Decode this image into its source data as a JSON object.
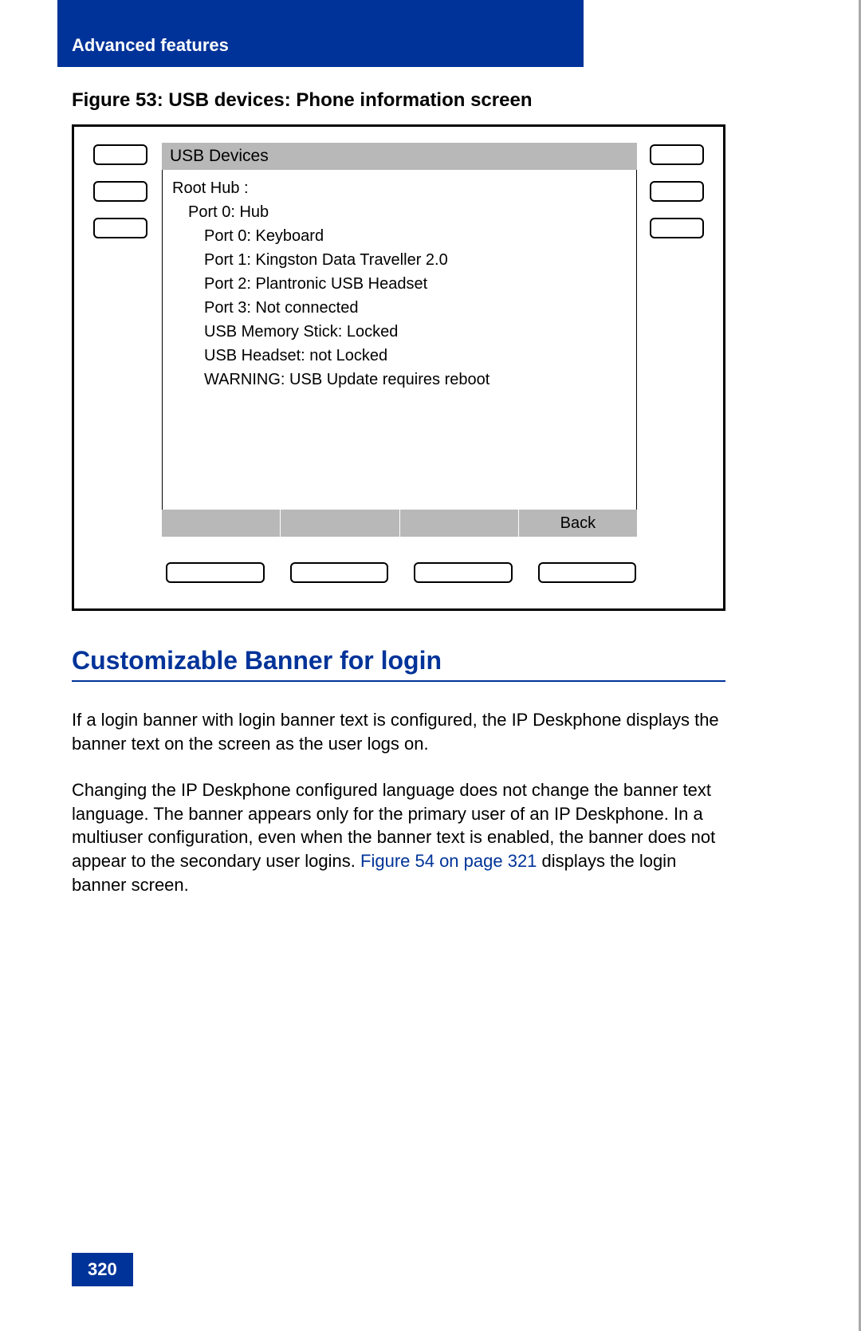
{
  "header": "Advanced features",
  "figure_caption": "Figure 53: USB devices: Phone information screen",
  "phone": {
    "title": "USB Devices",
    "lines": [
      {
        "text": "Root Hub :",
        "indent": 0
      },
      {
        "text": "Port 0: Hub",
        "indent": 1
      },
      {
        "text": "Port 0: Keyboard",
        "indent": 2
      },
      {
        "text": "Port 1: Kingston Data Traveller 2.0",
        "indent": 2
      },
      {
        "text": "Port 2: Plantronic USB Headset",
        "indent": 2
      },
      {
        "text": "Port 3: Not connected",
        "indent": 2
      },
      {
        "text": "USB Memory Stick: Locked",
        "indent": 2
      },
      {
        "text": "USB Headset: not Locked",
        "indent": 2
      },
      {
        "text": "WARNING: USB Update requires reboot",
        "indent": 2
      }
    ],
    "softkeys": [
      "",
      "",
      "",
      "Back"
    ]
  },
  "section_heading": "Customizable Banner for login",
  "paragraph1": "If a login banner with login banner text is configured, the IP Deskphone displays the banner text on the screen as the user logs on.",
  "paragraph2_a": "Changing the IP Deskphone configured language does not change the banner text language. The banner appears only for the primary user of an IP Deskphone. In a multiuser configuration, even when the banner text is enabled, the banner does not appear to the secondary user logins. ",
  "paragraph2_link": "Figure 54 on page 321",
  "paragraph2_b": " displays the login banner screen.",
  "page_number": "320"
}
